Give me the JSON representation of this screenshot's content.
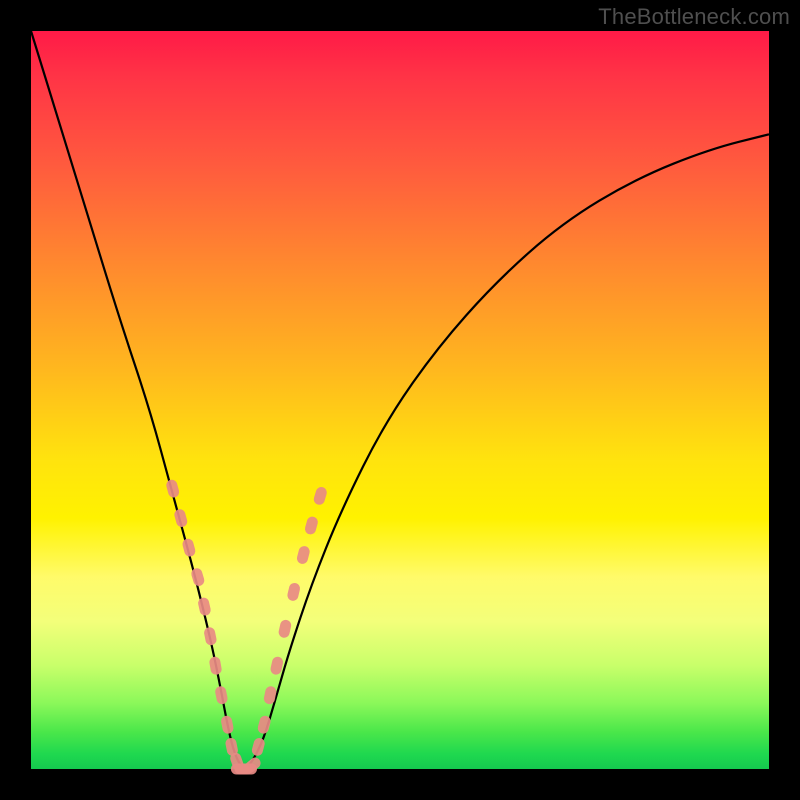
{
  "watermark": "TheBottleneck.com",
  "colors": {
    "frame": "#000000",
    "curve": "#000000",
    "marker_fill": "#e88a84",
    "marker_stroke": "#e88a84"
  },
  "chart_data": {
    "type": "line",
    "title": "",
    "xlabel": "",
    "ylabel": "",
    "xlim": [
      0,
      100
    ],
    "ylim": [
      0,
      100
    ],
    "grid": false,
    "legend": false,
    "curve": {
      "note": "V-shaped bottleneck curve, y is mismatch %, minimum near x≈27.5 where y≈0",
      "x": [
        0,
        4,
        8,
        12,
        16,
        19,
        22,
        24,
        25.5,
        27,
        28,
        29,
        30,
        31.5,
        33,
        35,
        38,
        42,
        48,
        55,
        63,
        72,
        82,
        92,
        100
      ],
      "y": [
        100,
        87,
        74,
        61,
        49,
        38,
        27,
        19,
        12,
        4,
        1,
        0,
        1,
        4,
        9,
        16,
        25,
        35,
        47,
        57,
        66,
        74,
        80,
        84,
        86
      ]
    },
    "series": [
      {
        "name": "left-branch-markers",
        "type": "scatter",
        "x": [
          19.2,
          20.3,
          21.4,
          22.6,
          23.5,
          24.3,
          25.0,
          25.8,
          26.6,
          27.2,
          27.9
        ],
        "y": [
          38.0,
          34.0,
          30.0,
          26.0,
          22.0,
          18.0,
          14.0,
          10.0,
          6.0,
          3.0,
          1.0
        ]
      },
      {
        "name": "minimum-markers",
        "type": "scatter",
        "x": [
          28.3,
          28.8,
          29.4,
          30.0
        ],
        "y": [
          0.0,
          0.0,
          0.0,
          0.5
        ]
      },
      {
        "name": "right-branch-markers",
        "type": "scatter",
        "x": [
          30.8,
          31.6,
          32.4,
          33.3,
          34.4,
          35.6,
          36.9,
          38.0,
          39.2
        ],
        "y": [
          3.0,
          6.0,
          10.0,
          14.0,
          19.0,
          24.0,
          29.0,
          33.0,
          37.0
        ]
      }
    ]
  }
}
